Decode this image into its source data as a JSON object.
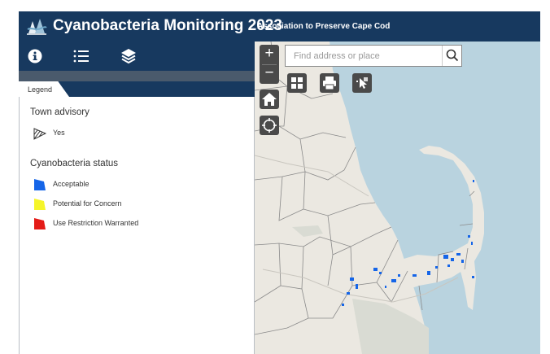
{
  "header": {
    "title": "Cyanobacteria Monitoring 2023",
    "subtitle": "Association to Preserve Cape Cod",
    "logo_icon": "cape-cod-logo-icon"
  },
  "toolbar": {
    "buttons": [
      {
        "icon": "info-icon"
      },
      {
        "icon": "legend-list-icon"
      },
      {
        "icon": "layers-icon"
      }
    ]
  },
  "panel": {
    "tab_label": "Legend",
    "sections": [
      {
        "heading": "Town advisory",
        "items": [
          {
            "label": "Yes",
            "swatch": "hatched",
            "color": "#333333"
          }
        ]
      },
      {
        "heading": "Cyanobacteria status",
        "items": [
          {
            "label": "Acceptable",
            "swatch": "solid",
            "color": "#1565e8"
          },
          {
            "label": "Potential for Concern",
            "swatch": "solid",
            "color": "#f5f52a"
          },
          {
            "label": "Use Restriction Warranted",
            "swatch": "solid",
            "color": "#e41b17"
          }
        ]
      }
    ]
  },
  "map": {
    "zoom_in_label": "+",
    "zoom_out_label": "−",
    "search": {
      "placeholder": "Find address or place",
      "value": ""
    },
    "controls": [
      "basemap-gallery-icon",
      "print-icon",
      "measure-icon",
      "home-icon",
      "locate-icon"
    ],
    "colors": {
      "water": "#b9d3df",
      "land": "#ebe8e1",
      "ponds": "#1565e8"
    }
  },
  "colors": {
    "header": "#17395f",
    "strip": "#4a5a6c",
    "control": "#4a4a4a"
  }
}
